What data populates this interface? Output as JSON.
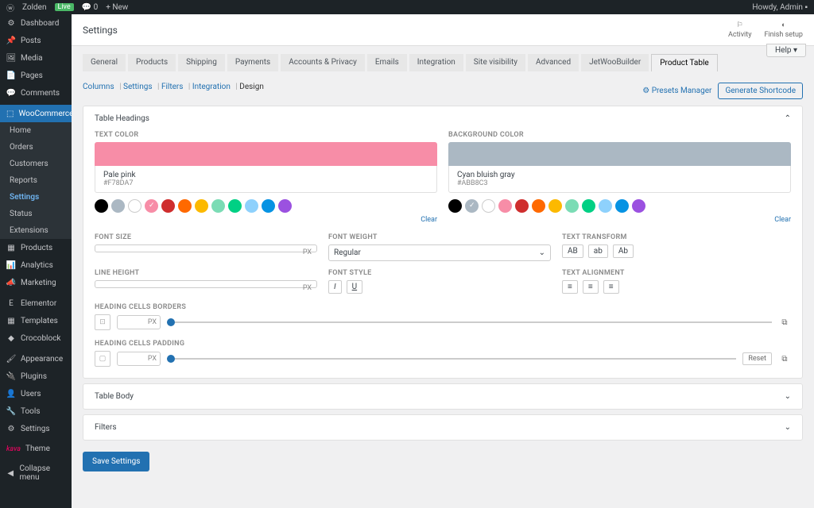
{
  "adminbar": {
    "site": "Zolden",
    "badge": "Live",
    "comments": "0",
    "new": "+ New",
    "howdy": "Howdy, Admin"
  },
  "sidebar": {
    "items": [
      {
        "icon": "⚙",
        "label": "Dashboard"
      },
      {
        "icon": "📌",
        "label": "Posts"
      },
      {
        "icon": "🖼",
        "label": "Media"
      },
      {
        "icon": "📄",
        "label": "Pages"
      },
      {
        "icon": "💬",
        "label": "Comments"
      }
    ],
    "woo": {
      "icon": "⬚",
      "label": "WooCommerce"
    },
    "woo_sub": [
      "Home",
      "Orders",
      "Customers",
      "Reports",
      "Settings",
      "Status",
      "Extensions"
    ],
    "items2": [
      {
        "icon": "▦",
        "label": "Products"
      },
      {
        "icon": "📊",
        "label": "Analytics"
      },
      {
        "icon": "📣",
        "label": "Marketing"
      }
    ],
    "items3": [
      {
        "icon": "E",
        "label": "Elementor"
      },
      {
        "icon": "▦",
        "label": "Templates"
      },
      {
        "icon": "◆",
        "label": "Crocoblock"
      }
    ],
    "items4": [
      {
        "icon": "🖌",
        "label": "Appearance"
      },
      {
        "icon": "🔌",
        "label": "Plugins"
      },
      {
        "icon": "👤",
        "label": "Users"
      },
      {
        "icon": "🔧",
        "label": "Tools"
      },
      {
        "icon": "⚙",
        "label": "Settings"
      }
    ],
    "theme": {
      "prefix": "kava",
      "label": "Theme"
    },
    "collapse": "Collapse menu"
  },
  "page": {
    "title": "Settings",
    "activity": "Activity",
    "finish": "Finish setup",
    "help": "Help ▾"
  },
  "tabs": [
    "General",
    "Products",
    "Shipping",
    "Payments",
    "Accounts & Privacy",
    "Emails",
    "Integration",
    "Site visibility",
    "Advanced",
    "JetWooBuilder",
    "Product Table"
  ],
  "subtabs": {
    "links": [
      "Columns",
      "Settings",
      "Filters",
      "Integration",
      "Design"
    ],
    "presets": "Presets Manager",
    "gen": "Generate Shortcode"
  },
  "sections": {
    "headings": "Table Headings",
    "body": "Table Body",
    "filters": "Filters"
  },
  "labels": {
    "text_color": "TEXT COLOR",
    "bg_color": "BACKGROUND COLOR",
    "font_size": "FONT SIZE",
    "font_weight": "FONT WEIGHT",
    "text_transform": "TEXT TRANSFORM",
    "line_height": "LINE HEIGHT",
    "font_style": "FONT STYLE",
    "text_align": "TEXT ALIGNMENT",
    "borders": "HEADING CELLS BORDERS",
    "padding": "HEADING CELLS PADDING",
    "clear": "Clear",
    "reset": "Reset"
  },
  "text_color": {
    "name": "Pale pink",
    "hex": "#F78DA7",
    "swatch": "#f78da7"
  },
  "bg_color": {
    "name": "Cyan bluish gray",
    "hex": "#ABB8C3",
    "swatch": "#abb8c3"
  },
  "palette": [
    "#000000",
    "#abb8c3",
    "#ffffff",
    "#f78da7",
    "#cf2e2e",
    "#ff6900",
    "#fcb900",
    "#7bdcb5",
    "#00d084",
    "#8ed1fc",
    "#0693e3",
    "#9b51e0"
  ],
  "font_weight": "Regular",
  "transforms": [
    "AB",
    "ab",
    "Ab"
  ],
  "unit": "PX",
  "save": "Save Settings"
}
